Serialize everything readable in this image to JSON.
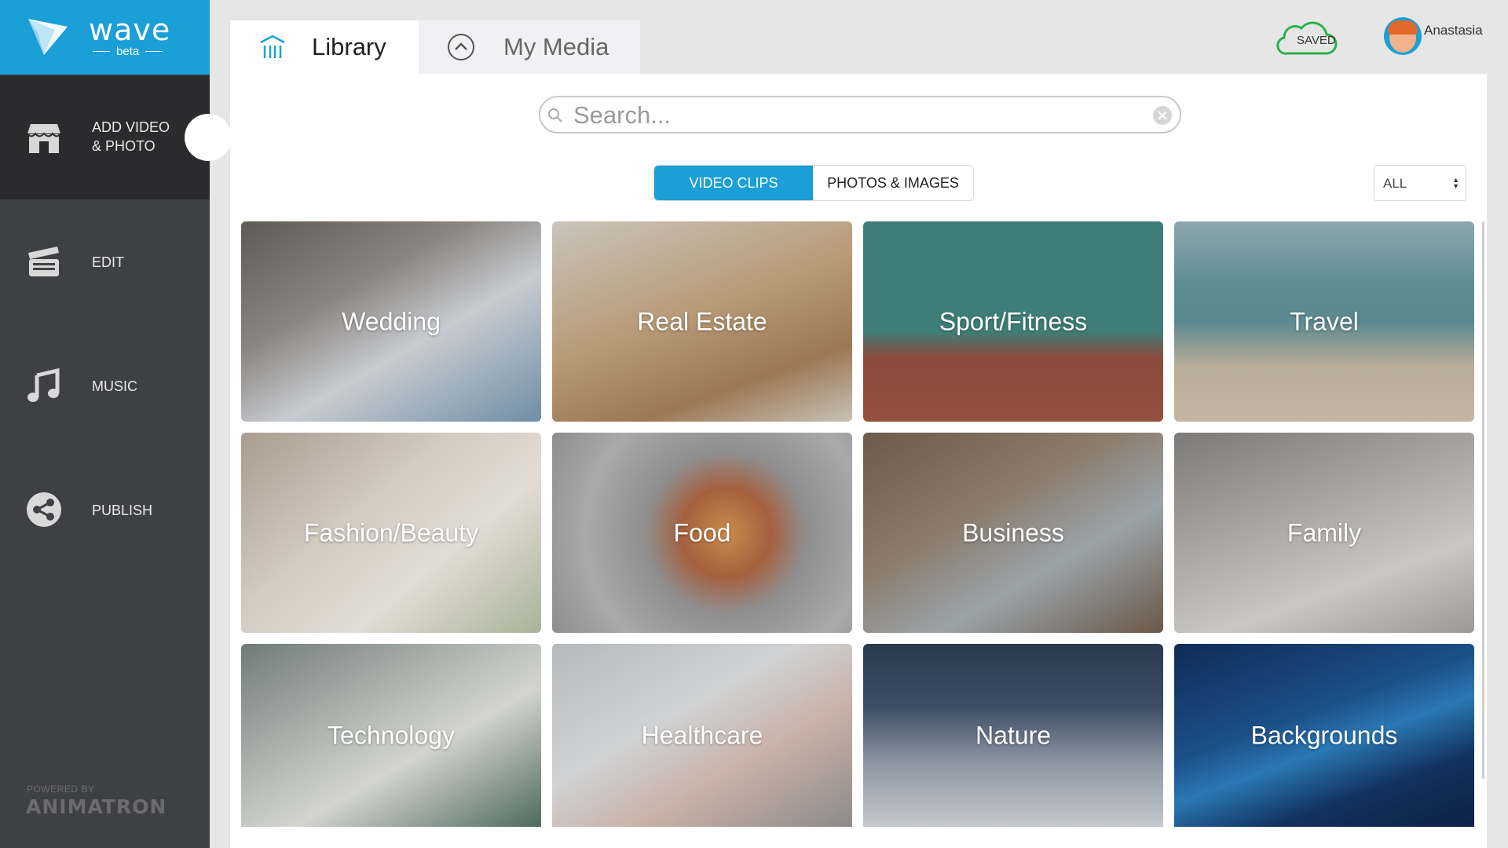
{
  "brand": {
    "name": "wave",
    "sub": "beta"
  },
  "sidebar": {
    "items": [
      {
        "label": "ADD VIDEO & PHOTO",
        "line1": "ADD VIDEO",
        "line2": "& PHOTO",
        "icon": "store-icon",
        "active": true
      },
      {
        "label": "EDIT",
        "icon": "clapperboard-icon",
        "active": false
      },
      {
        "label": "MUSIC",
        "icon": "music-note-icon",
        "active": false
      },
      {
        "label": "PUBLISH",
        "icon": "share-icon",
        "active": false
      }
    ],
    "powered_by": "POWERED BY",
    "powered_brand": "ANIMATRON"
  },
  "tabs": [
    {
      "label": "Library",
      "icon": "library-icon",
      "active": true
    },
    {
      "label": "My Media",
      "icon": "upload-icon",
      "active": false
    }
  ],
  "status": {
    "saved_label": "SAVED",
    "icon": "cloud-icon",
    "accent": "#2bb24c"
  },
  "user": {
    "name": "Anastasia"
  },
  "search": {
    "placeholder": "Search...",
    "value": ""
  },
  "media_type": {
    "options": [
      "VIDEO CLIPS",
      "PHOTOS & IMAGES"
    ],
    "selected": "VIDEO CLIPS"
  },
  "filter": {
    "selected": "ALL"
  },
  "categories": [
    "Wedding",
    "Real Estate",
    "Sport/Fitness",
    "Travel",
    "Fashion/Beauty",
    "Food",
    "Business",
    "Family",
    "Technology",
    "Healthcare",
    "Nature",
    "Backgrounds"
  ],
  "colors": {
    "accent": "#1a9fd6",
    "sidebar": "#3f4043",
    "sidebar_active": "#2b2b2d"
  }
}
